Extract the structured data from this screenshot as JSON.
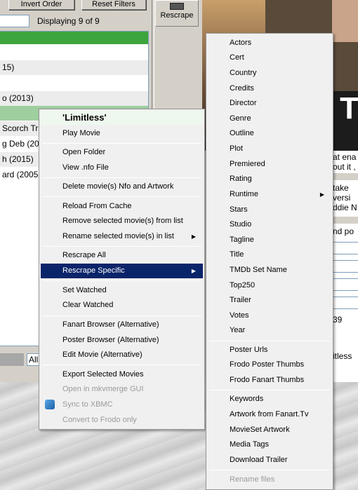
{
  "toolbar": {
    "invert_order": "Invert Order",
    "reset_filters": "Reset Filters",
    "displaying": "Displaying 9 of 9",
    "rescrape": "Rescrape"
  },
  "movie_list": {
    "rows": [
      "",
      "",
      "15)",
      "",
      "o (2013)",
      "",
      "",
      "Scorch Tr",
      "g Deb (201",
      "h (2015)",
      "ard (2005"
    ]
  },
  "filter_combo": "All",
  "poster": {
    "title_fragment": "T"
  },
  "side_panel": {
    "lines": [
      "at ena",
      "out it ,",
      "take",
      "versi",
      "ddie N",
      "nd po",
      "39",
      "itless"
    ]
  },
  "context_menu": {
    "title": "'Limitless'",
    "items": {
      "play_movie": "Play Movie",
      "open_folder": "Open Folder",
      "view_nfo": "View .nfo File",
      "delete_nfo": "Delete movie(s) Nfo and Artwork",
      "reload_cache": "Reload From Cache",
      "remove_selected": "Remove selected movie(s) from list",
      "rename_selected": "Rename selected movie(s) in list",
      "rescrape_all": "Rescrape All",
      "rescrape_specific": "Rescrape Specific",
      "set_watched": "Set Watched",
      "clear_watched": "Clear Watched",
      "fanart_browser": "Fanart Browser (Alternative)",
      "poster_browser": "Poster Browser (Alternative)",
      "edit_movie": "Edit Movie (Alternative)",
      "export_selected": "Export Selected Movies",
      "open_mkvmerge": "Open in mkvmerge GUI",
      "sync_xbmc": "Sync to XBMC",
      "convert_frodo": "Convert to Frodo only"
    }
  },
  "submenu": {
    "items": {
      "actors": "Actors",
      "cert": "Cert",
      "country": "Country",
      "credits": "Credits",
      "director": "Director",
      "genre": "Genre",
      "outline": "Outline",
      "plot": "Plot",
      "premiered": "Premiered",
      "rating": "Rating",
      "runtime": "Runtime",
      "stars": "Stars",
      "studio": "Studio",
      "tagline": "Tagline",
      "title": "Title",
      "tmdb_set_name": "TMDb Set Name",
      "top250": "Top250",
      "trailer": "Trailer",
      "votes": "Votes",
      "year": "Year",
      "poster_urls": "Poster Urls",
      "frodo_poster_thumbs": "Frodo Poster Thumbs",
      "frodo_fanart_thumbs": "Frodo Fanart Thumbs",
      "keywords": "Keywords",
      "artwork_fanart_tv": "Artwork from Fanart.Tv",
      "movieset_artwork": "MovieSet Artwork",
      "media_tags": "Media Tags",
      "download_trailer": "Download Trailer",
      "rename_files": "Rename files"
    }
  },
  "icons": {
    "submenu_arrow": "▶",
    "kodi": "kodi-icon"
  }
}
